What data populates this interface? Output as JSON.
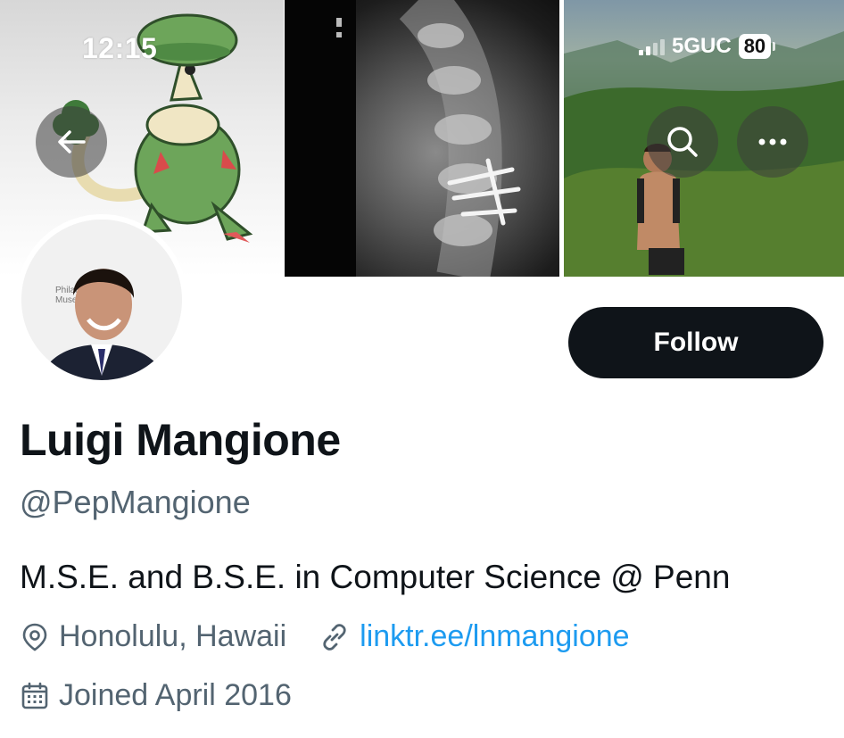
{
  "status_bar": {
    "time": "12:15",
    "network": "5GUC",
    "battery": "80"
  },
  "header": {
    "back_icon": "arrow-left-icon",
    "search_icon": "search-icon",
    "more_icon": "more-horizontal-icon"
  },
  "profile": {
    "display_name": "Luigi Mangione",
    "handle": "@PepMangione",
    "follow_label": "Follow",
    "bio": "M.S.E. and B.S.E. in Computer Science @ Penn",
    "location": "Honolulu, Hawaii",
    "website": "linktr.ee/lnmangione",
    "joined": "Joined April 2016",
    "avatar_backdrop_text": "Philad\nMuseu"
  },
  "colors": {
    "follow_bg": "#0f1419",
    "link": "#1d9bf0",
    "secondary_text": "#536471",
    "primary_text": "#0f1419"
  }
}
